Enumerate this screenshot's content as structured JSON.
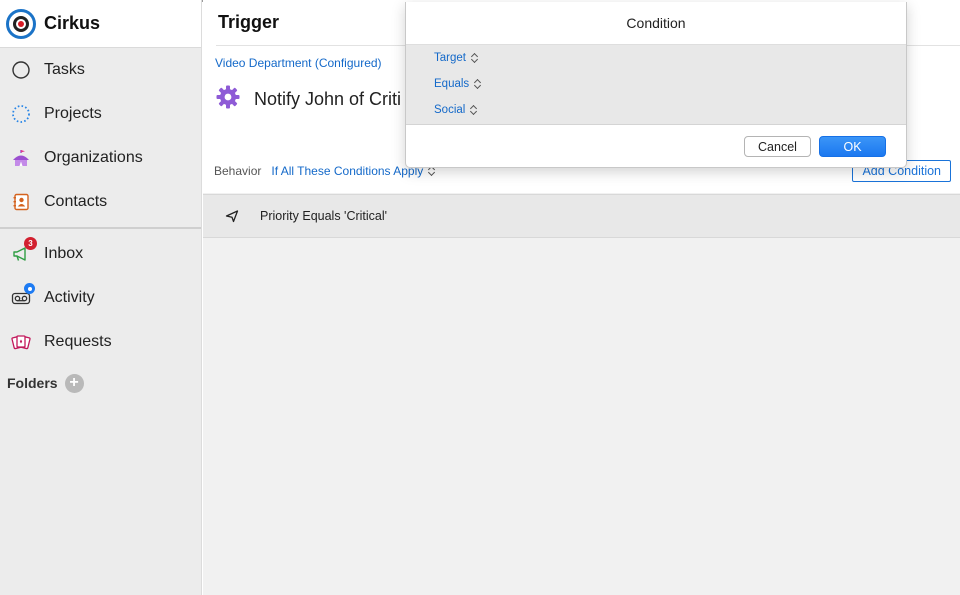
{
  "app": {
    "name": "Cirkus"
  },
  "sidebar": {
    "items": [
      {
        "label": "Tasks",
        "icon": "circle-outline-icon"
      },
      {
        "label": "Projects",
        "icon": "dotted-circle-icon"
      },
      {
        "label": "Organizations",
        "icon": "circus-tent-icon"
      },
      {
        "label": "Contacts",
        "icon": "contact-card-icon"
      },
      {
        "label": "Inbox",
        "icon": "megaphone-icon",
        "badge": "3"
      },
      {
        "label": "Activity",
        "icon": "voicemail-icon"
      },
      {
        "label": "Requests",
        "icon": "playing-cards-icon"
      }
    ],
    "folders_label": "Folders",
    "add_folder": "+"
  },
  "main": {
    "title": "Trigger",
    "department_link": "Video Department (Configured)",
    "trigger_name": "Notify John of Criti",
    "behavior_label": "Behavior",
    "behavior_value": "If All These Conditions Apply",
    "add_condition_label": "Add Condition",
    "conditions": [
      {
        "text": "Priority Equals 'Critical'"
      }
    ]
  },
  "dialog": {
    "title": "Condition",
    "fields": {
      "target": "Target",
      "operator": "Equals",
      "value": "Social"
    },
    "cancel_label": "Cancel",
    "ok_label": "OK"
  },
  "colors": {
    "accent": "#1a73d9",
    "badge_red": "#d2202f",
    "sidebar_bg": "#ececec"
  }
}
